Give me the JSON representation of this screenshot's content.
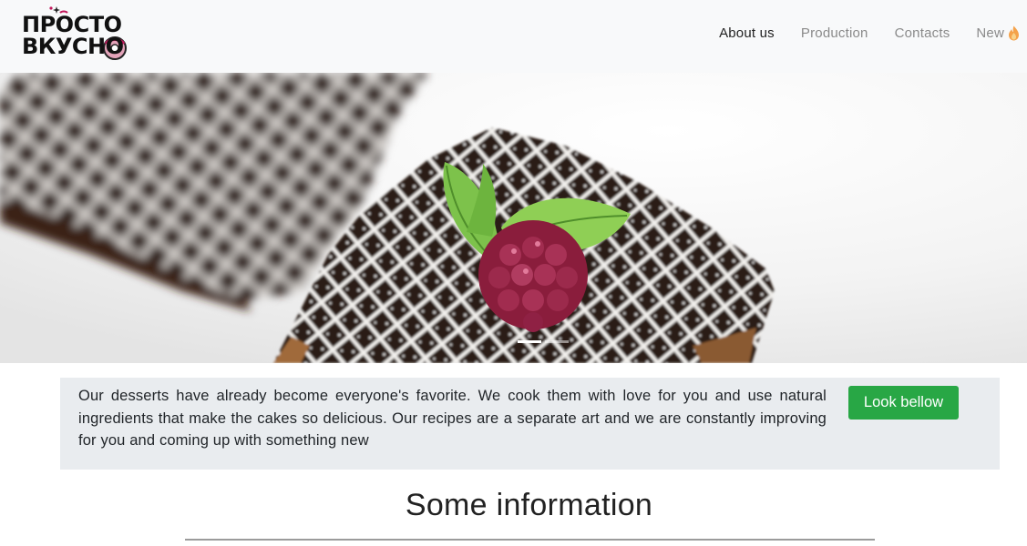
{
  "brand": {
    "logo_line1": "ПРОСТО",
    "logo_line2": "ВКУСНО"
  },
  "nav": {
    "items": [
      {
        "label": "About us",
        "active": true
      },
      {
        "label": "Production",
        "active": false
      },
      {
        "label": "Contacts",
        "active": false
      },
      {
        "label": "New",
        "active": false,
        "icon": "fire-emoji-icon"
      }
    ]
  },
  "hero": {
    "image": "chocolate brownie dessert with powdered sugar, raspberry and mint",
    "slides_total": 2,
    "active_slide": 1
  },
  "info": {
    "text": "Our desserts have already become everyone's favorite. We cook them with love for you and use natural ingredients that make the cakes so delicious. Our recipes are a separate art and we are constantly improving for you and coming up with something new",
    "button_label": "Look bellow"
  },
  "section": {
    "title": "Some information"
  },
  "colors": {
    "navbar_bg": "#f8f9fa",
    "info_bg": "#e9ecef",
    "button_green": "#28a745",
    "logo_accent": "#c2185b"
  }
}
